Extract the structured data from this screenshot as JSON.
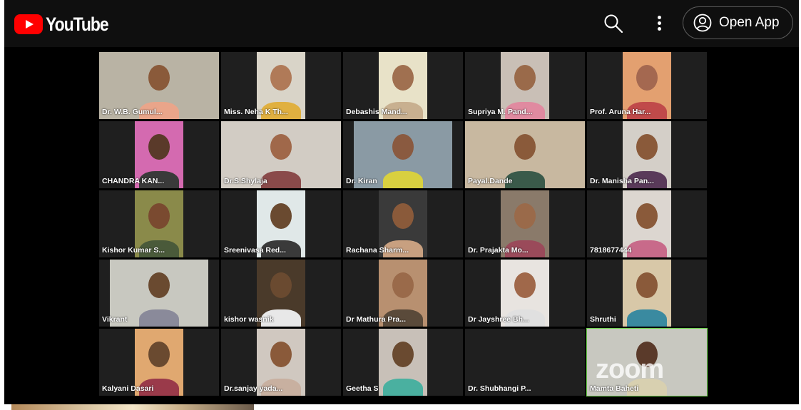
{
  "app": {
    "logo_text": "YouTube",
    "open_app_label": "Open App"
  },
  "icons": {
    "search": "search-icon",
    "more": "more-vertical-icon",
    "account": "account-circle-icon",
    "logo": "youtube-logo-icon"
  },
  "watermark": "zoom",
  "participants": [
    {
      "name": "Dr. W.B. Gumul...",
      "bg": "#b9b3a4",
      "skin": "#8a5a3a",
      "shirt": "#e9a58a",
      "wide": "wide"
    },
    {
      "name": "Miss. Neha K Th...",
      "bg": "#d9d4c8",
      "skin": "#b07a58",
      "shirt": "#e0b040",
      "wide": ""
    },
    {
      "name": "Debashis Mand...",
      "bg": "#e8e2c8",
      "skin": "#a07050",
      "shirt": "#c8b090",
      "wide": ""
    },
    {
      "name": "Supriya M. Pand...",
      "bg": "#c9bfb6",
      "skin": "#9a6a4a",
      "shirt": "#e08aa0",
      "wide": ""
    },
    {
      "name": "Prof. Aruna Har...",
      "bg": "#e3a070",
      "skin": "#a46850",
      "shirt": "#c04a4a",
      "wide": ""
    },
    {
      "name": "CHANDRA KAN...",
      "bg": "#d46ab0",
      "skin": "#5a3a2a",
      "shirt": "#3a3a3a",
      "wide": ""
    },
    {
      "name": "Dr.S.Shylaja",
      "bg": "#d2ccc4",
      "skin": "#a0684a",
      "shirt": "#8a4a4a",
      "wide": "wide"
    },
    {
      "name": "Dr. Kiran",
      "bg": "#8a9aa4",
      "skin": "#8a5a40",
      "shirt": "#d8d040",
      "wide": "mid"
    },
    {
      "name": "Payal.Dande",
      "bg": "#c8b8a0",
      "skin": "#8a5a3a",
      "shirt": "#3a5a4a",
      "wide": "wide"
    },
    {
      "name": "Dr. Manisha Pan...",
      "bg": "#d4cfc8",
      "skin": "#8a5a3a",
      "shirt": "#5a3a5a",
      "wide": ""
    },
    {
      "name": "Kishor Kumar S...",
      "bg": "#8a8a4a",
      "skin": "#7a4a30",
      "shirt": "#4a5a3a",
      "wide": ""
    },
    {
      "name": "Sreenivasa Red...",
      "bg": "#e0e8e8",
      "skin": "#6a4a30",
      "shirt": "#3a3a3a",
      "wide": ""
    },
    {
      "name": "Rachana Sharm...",
      "bg": "#3a3a3a",
      "skin": "#8a5a3a",
      "shirt": "#c8a080",
      "wide": ""
    },
    {
      "name": "Dr. Prajakta Mo...",
      "bg": "#8a7a6a",
      "skin": "#9a6a4a",
      "shirt": "#9a4a5a",
      "wide": ""
    },
    {
      "name": "7818677444",
      "bg": "#dcd6d0",
      "skin": "#8a5a3a",
      "shirt": "#c86a8a",
      "wide": ""
    },
    {
      "name": "Vikrant",
      "bg": "#c8c8c0",
      "skin": "#6a4a30",
      "shirt": "#8a8a9a",
      "wide": "mid"
    },
    {
      "name": "kishor wasnik",
      "bg": "#4a3a2a",
      "skin": "#6a4a30",
      "shirt": "#e8e8e8",
      "wide": ""
    },
    {
      "name": "Dr Mathura Pra...",
      "bg": "#b89070",
      "skin": "#9a6a4a",
      "shirt": "#5a4a3a",
      "wide": ""
    },
    {
      "name": "Dr  Jayshree Bh...",
      "bg": "#e8e4e0",
      "skin": "#a0684a",
      "shirt": "#e0e0e0",
      "wide": ""
    },
    {
      "name": "Shruthi",
      "bg": "#d8c8a8",
      "skin": "#8a5a3a",
      "shirt": "#3a8aa0",
      "wide": ""
    },
    {
      "name": "Kalyani Dasari",
      "bg": "#e0a870",
      "skin": "#6a4a30",
      "shirt": "#9a3a4a",
      "wide": ""
    },
    {
      "name": "Dr.sanjay yada...",
      "bg": "#d0c8c0",
      "skin": "#8a5a3a",
      "shirt": "#c8b0a0",
      "wide": ""
    },
    {
      "name": "Geetha S",
      "bg": "#c8c0b8",
      "skin": "#6a4a30",
      "shirt": "#4ab0a0",
      "wide": ""
    },
    {
      "name": "Dr. Shubhangi P...",
      "bg": "",
      "skin": "",
      "shirt": "",
      "wide": "none"
    },
    {
      "name": "Mamta Baheti",
      "bg": "#c8c8c0",
      "skin": "#5a3a2a",
      "shirt": "#d8d0b0",
      "wide": "wide",
      "active": true
    }
  ]
}
